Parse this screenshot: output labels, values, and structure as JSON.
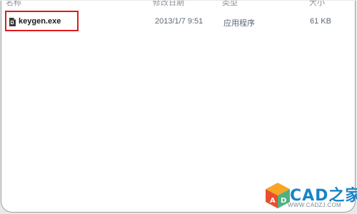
{
  "columns": {
    "name": "名称",
    "date": "修改日期",
    "type": "类型",
    "size": "大小"
  },
  "files": [
    {
      "icon": "keygen-exe-icon",
      "name": "keygen.exe",
      "date": "2013/1/7 9:51",
      "type": "应用程序",
      "size": "61 KB"
    }
  ],
  "watermark": {
    "brand": "CAD之家",
    "url": "WWW.CADZJ.COM"
  },
  "colors": {
    "highlight": "#e0191d",
    "brand_blue": "#1784c7"
  }
}
